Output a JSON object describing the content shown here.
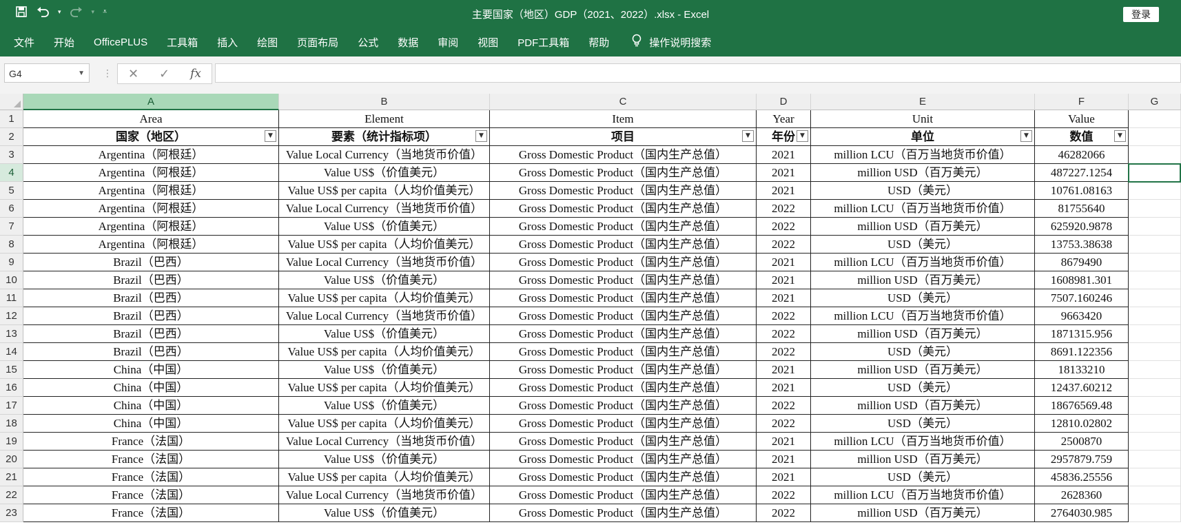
{
  "window": {
    "title": "主要国家（地区）GDP（2021、2022）.xlsx  -  Excel",
    "login_label": "登录"
  },
  "qat": {
    "save_icon": "save-icon",
    "undo_icon": "undo-icon",
    "redo_icon": "redo-icon",
    "customize_icon": "customize-icon"
  },
  "ribbon": {
    "tabs": [
      "文件",
      "开始",
      "OfficePLUS",
      "工具箱",
      "插入",
      "绘图",
      "页面布局",
      "公式",
      "数据",
      "审阅",
      "视图",
      "PDF工具箱",
      "帮助"
    ],
    "search_label": "操作说明搜索"
  },
  "formula_bar": {
    "name_box": "G4",
    "fx_label": "fx",
    "formula_value": ""
  },
  "columns": [
    "A",
    "B",
    "C",
    "D",
    "E",
    "F",
    "G"
  ],
  "selected_cell": "G4",
  "header_row1": [
    "Area",
    "Element",
    "Item",
    "Year",
    "Unit",
    "Value"
  ],
  "header_row2": [
    "国家（地区）",
    "要素（统计指标项）",
    "项目",
    "年份",
    "单位",
    "数值"
  ],
  "rows": [
    [
      "Argentina（阿根廷）",
      "Value Local Currency（当地货币价值）",
      "Gross Domestic Product（国内生产总值）",
      "2021",
      "million LCU（百万当地货币价值）",
      "46282066"
    ],
    [
      "Argentina（阿根廷）",
      "Value US$（价值美元）",
      "Gross Domestic Product（国内生产总值）",
      "2021",
      "million USD（百万美元）",
      "487227.1254"
    ],
    [
      "Argentina（阿根廷）",
      "Value US$ per capita（人均价值美元）",
      "Gross Domestic Product（国内生产总值）",
      "2021",
      "USD（美元）",
      "10761.08163"
    ],
    [
      "Argentina（阿根廷）",
      "Value Local Currency（当地货币价值）",
      "Gross Domestic Product（国内生产总值）",
      "2022",
      "million LCU（百万当地货币价值）",
      "81755640"
    ],
    [
      "Argentina（阿根廷）",
      "Value US$（价值美元）",
      "Gross Domestic Product（国内生产总值）",
      "2022",
      "million USD（百万美元）",
      "625920.9878"
    ],
    [
      "Argentina（阿根廷）",
      "Value US$ per capita（人均价值美元）",
      "Gross Domestic Product（国内生产总值）",
      "2022",
      "USD（美元）",
      "13753.38638"
    ],
    [
      "Brazil（巴西）",
      "Value Local Currency（当地货币价值）",
      "Gross Domestic Product（国内生产总值）",
      "2021",
      "million LCU（百万当地货币价值）",
      "8679490"
    ],
    [
      "Brazil（巴西）",
      "Value US$（价值美元）",
      "Gross Domestic Product（国内生产总值）",
      "2021",
      "million USD（百万美元）",
      "1608981.301"
    ],
    [
      "Brazil（巴西）",
      "Value US$ per capita（人均价值美元）",
      "Gross Domestic Product（国内生产总值）",
      "2021",
      "USD（美元）",
      "7507.160246"
    ],
    [
      "Brazil（巴西）",
      "Value Local Currency（当地货币价值）",
      "Gross Domestic Product（国内生产总值）",
      "2022",
      "million LCU（百万当地货币价值）",
      "9663420"
    ],
    [
      "Brazil（巴西）",
      "Value US$（价值美元）",
      "Gross Domestic Product（国内生产总值）",
      "2022",
      "million USD（百万美元）",
      "1871315.956"
    ],
    [
      "Brazil（巴西）",
      "Value US$ per capita（人均价值美元）",
      "Gross Domestic Product（国内生产总值）",
      "2022",
      "USD（美元）",
      "8691.122356"
    ],
    [
      "China（中国）",
      "Value US$（价值美元）",
      "Gross Domestic Product（国内生产总值）",
      "2021",
      "million USD（百万美元）",
      "18133210"
    ],
    [
      "China（中国）",
      "Value US$ per capita（人均价值美元）",
      "Gross Domestic Product（国内生产总值）",
      "2021",
      "USD（美元）",
      "12437.60212"
    ],
    [
      "China（中国）",
      "Value US$（价值美元）",
      "Gross Domestic Product（国内生产总值）",
      "2022",
      "million USD（百万美元）",
      "18676569.48"
    ],
    [
      "China（中国）",
      "Value US$ per capita（人均价值美元）",
      "Gross Domestic Product（国内生产总值）",
      "2022",
      "USD（美元）",
      "12810.02802"
    ],
    [
      "France（法国）",
      "Value Local Currency（当地货币价值）",
      "Gross Domestic Product（国内生产总值）",
      "2021",
      "million LCU（百万当地货币价值）",
      "2500870"
    ],
    [
      "France（法国）",
      "Value US$（价值美元）",
      "Gross Domestic Product（国内生产总值）",
      "2021",
      "million USD（百万美元）",
      "2957879.759"
    ],
    [
      "France（法国）",
      "Value US$ per capita（人均价值美元）",
      "Gross Domestic Product（国内生产总值）",
      "2021",
      "USD（美元）",
      "45836.25556"
    ],
    [
      "France（法国）",
      "Value Local Currency（当地货币价值）",
      "Gross Domestic Product（国内生产总值）",
      "2022",
      "million LCU（百万当地货币价值）",
      "2628360"
    ],
    [
      "France（法国）",
      "Value US$（价值美元）",
      "Gross Domestic Product（国内生产总值）",
      "2022",
      "million USD（百万美元）",
      "2764030.985"
    ]
  ],
  "colors": {
    "excel_green": "#1f7244",
    "selection": "#217346",
    "header_highlight": "#a9d8b8"
  }
}
